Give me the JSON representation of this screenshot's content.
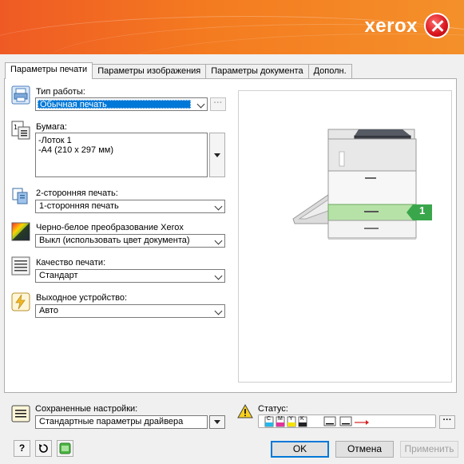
{
  "brand": {
    "name": "xerox"
  },
  "tabs": [
    {
      "label": "Параметры печати"
    },
    {
      "label": "Параметры изображения"
    },
    {
      "label": "Параметры документа"
    },
    {
      "label": "Дополн."
    }
  ],
  "job_type": {
    "label": "Тип работы:",
    "value": "Обычная печать"
  },
  "paper": {
    "label": "Бумага:",
    "line1": "-Лоток 1",
    "line2": "-А4 (210 x 297 мм)"
  },
  "duplex": {
    "label": "2-сторонняя печать:",
    "value": "1-сторонняя печать"
  },
  "bw_conversion": {
    "label": "Черно-белое преобразование Xerox",
    "value": "Выкл (использовать цвет документа)"
  },
  "quality": {
    "label": "Качество печати:",
    "value": "Стандарт"
  },
  "output": {
    "label": "Выходное устройство:",
    "value": "Авто"
  },
  "preview": {
    "tray_number": "1"
  },
  "saved_settings": {
    "label": "Сохраненные настройки:",
    "value": "Стандартные параметры драйвера"
  },
  "status": {
    "label": "Статус:",
    "toners": [
      "C",
      "M",
      "Y",
      "K"
    ]
  },
  "buttons": {
    "ok": "OK",
    "cancel": "Отмена",
    "apply": "Применить",
    "help": "?"
  },
  "colors": {
    "accent": "#0078d7",
    "banner": "#f47b20",
    "tray_highlight": "#3aa64b"
  }
}
